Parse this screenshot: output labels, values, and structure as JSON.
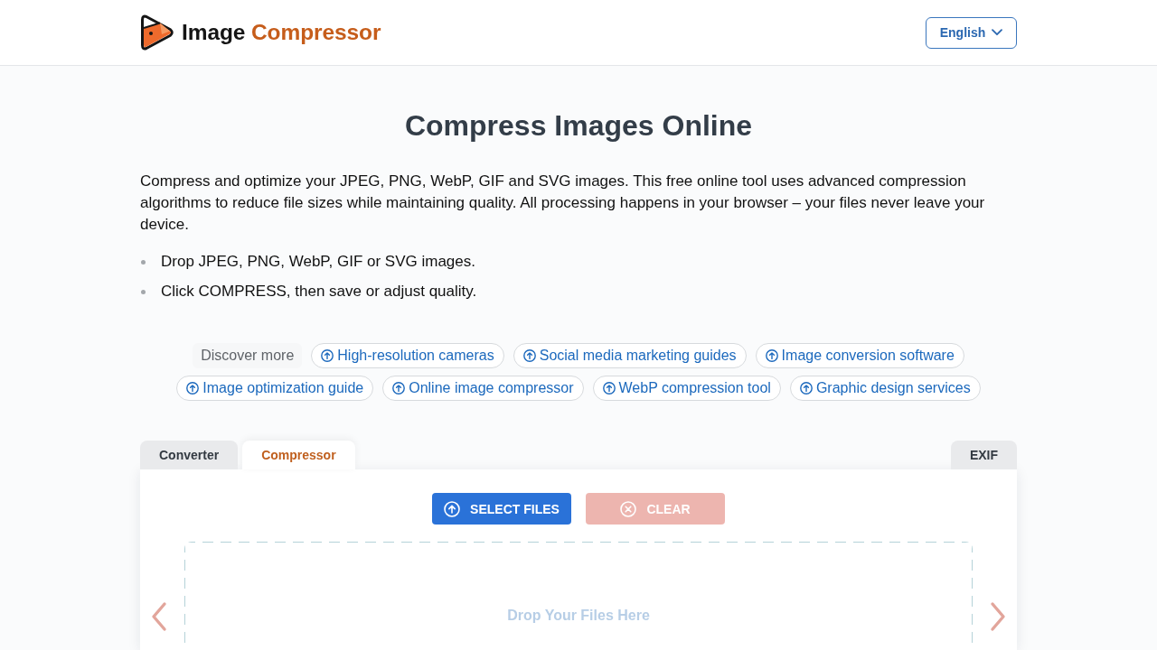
{
  "header": {
    "logo": {
      "name": "Image",
      "highlight": "Compressor"
    },
    "language": "English"
  },
  "title": "Compress Images Online",
  "intro": "Compress and optimize your JPEG, PNG, WebP, GIF and SVG images. This free online tool uses advanced compression algorithms to reduce file sizes while maintaining quality. All processing happens in your browser – your files never leave your device.",
  "steps": [
    "Drop JPEG, PNG, WebP, GIF or SVG images.",
    "Click COMPRESS, then save or adjust quality."
  ],
  "discover": {
    "label": "Discover more",
    "links": [
      "High-resolution cameras",
      "Social media marketing guides",
      "Image conversion software",
      "Image optimization guide",
      "Online image compressor",
      "WebP compression tool",
      "Graphic design services"
    ]
  },
  "tabs": [
    {
      "label": "Converter",
      "selected": false
    },
    {
      "label": "Compressor",
      "selected": true
    }
  ],
  "end_tabs": [
    {
      "label": "EXIF",
      "selected": false
    }
  ],
  "actions": [
    {
      "label": "SELECT FILES",
      "kind": "select",
      "disabled": false
    },
    {
      "label": "CLEAR",
      "kind": "clear",
      "disabled": true
    }
  ],
  "drop_zone": {
    "text": "Drop Your Files Here"
  }
}
